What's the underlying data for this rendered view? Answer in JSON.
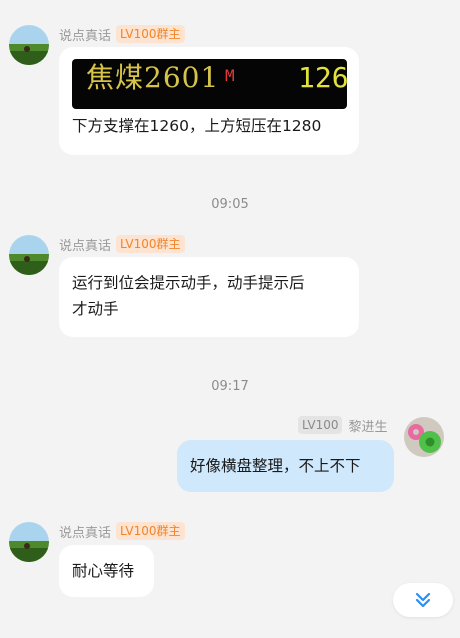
{
  "messages": [
    {
      "sender": "说点真话",
      "badge": "LV100群主",
      "quote": {
        "name": "焦煤2601",
        "flag": "M",
        "price": "126"
      },
      "text": "下方支撑在1260，上方短压在1280"
    },
    {
      "time": "09:05"
    },
    {
      "sender": "说点真话",
      "badge": "LV100群主",
      "text_lines": [
        "运行到位会提示动手，动手提示后",
        "才动手"
      ]
    },
    {
      "time": "09:17"
    },
    {
      "sender": "黎进生",
      "badge": "LV100",
      "text": "好像横盘整理，不上不下"
    },
    {
      "sender": "说点真话",
      "badge": "LV100群主",
      "text": "耐心等待"
    }
  ],
  "icons": {
    "scroll_down": "double-chevron-down-icon"
  },
  "colors": {
    "badge_orange": "#f0852a",
    "my_bubble": "#cfe8fb",
    "scroll_arrow": "#2a8ff7"
  }
}
